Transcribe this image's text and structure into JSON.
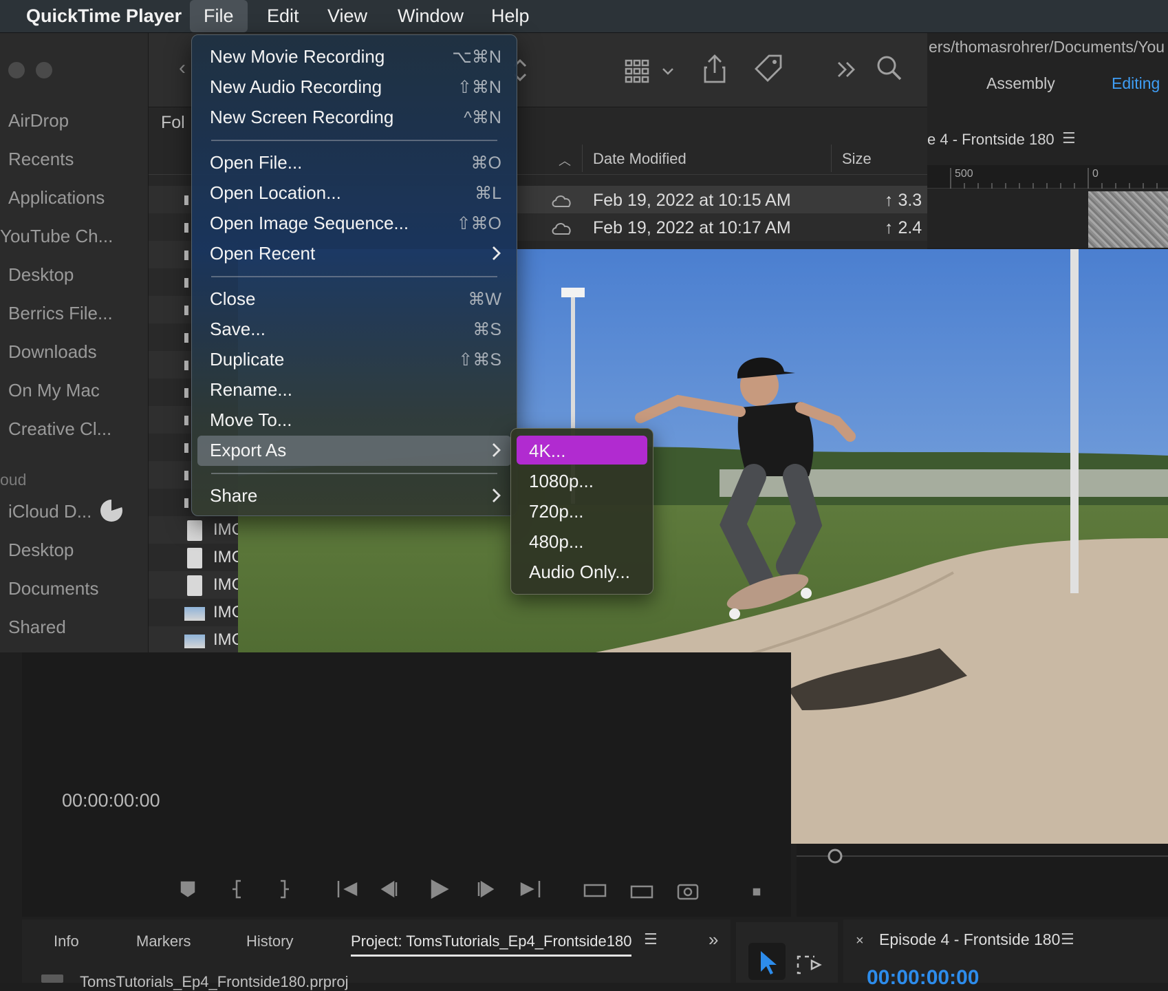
{
  "menubar": {
    "app_name": "QuickTime Player",
    "items": [
      "File",
      "Edit",
      "View",
      "Window",
      "Help"
    ]
  },
  "finder": {
    "sidebar": {
      "items": [
        "AirDrop",
        "Recents",
        "Applications",
        "YouTube Ch...",
        "Desktop",
        "Berrics File...",
        "Downloads",
        "On My Mac",
        "Creative Cl..."
      ],
      "icloud_header": "oud",
      "icloud_items": [
        "iCloud D...",
        "Desktop",
        "Documents",
        "Shared"
      ]
    },
    "folder_col_partial": "Fol",
    "path_text": "ers/thomasrohrer/Documents/You",
    "columns": {
      "date": "Date Modified",
      "size": "Size"
    },
    "rows": [
      {
        "date": "Feb 19, 2022 at 10:15 AM",
        "size": "3.3"
      },
      {
        "date": "Feb 19, 2022 at 10:17 AM",
        "size": "2.4"
      }
    ],
    "file_names": [
      "IMC",
      "IMC",
      "IMC",
      "IMC",
      "IMC"
    ]
  },
  "file_menu": {
    "groups": [
      [
        {
          "label": "New Movie Recording",
          "shortcut": "⌥⌘N"
        },
        {
          "label": "New Audio Recording",
          "shortcut": "⇧⌘N"
        },
        {
          "label": "New Screen Recording",
          "shortcut": "^⌘N"
        }
      ],
      [
        {
          "label": "Open File...",
          "shortcut": "⌘O"
        },
        {
          "label": "Open Location...",
          "shortcut": "⌘L"
        },
        {
          "label": "Open Image Sequence...",
          "shortcut": "⇧⌘O"
        },
        {
          "label": "Open Recent",
          "submenu": true
        }
      ],
      [
        {
          "label": "Close",
          "shortcut": "⌘W"
        },
        {
          "label": "Save...",
          "shortcut": "⌘S"
        },
        {
          "label": "Duplicate",
          "shortcut": "⇧⌘S"
        },
        {
          "label": "Rename..."
        },
        {
          "label": "Move To..."
        },
        {
          "label": "Export As",
          "submenu": true,
          "highlighted": true
        }
      ],
      [
        {
          "label": "Share",
          "submenu": true
        }
      ]
    ]
  },
  "export_submenu": {
    "items": [
      "4K...",
      "1080p...",
      "720p...",
      "480p...",
      "Audio Only..."
    ],
    "selected": "4K..."
  },
  "premiere": {
    "workspace_tabs": [
      "Assembly",
      "Editing"
    ],
    "active_workspace": "Editing",
    "sequence_title_partial": "e 4 - Frontside 180",
    "ruler_labels": [
      "500",
      "0"
    ],
    "timecode": "00:00:00:00",
    "panel_tabs": [
      "Info",
      "Markers",
      "History",
      "Project: TomsTutorials_Ep4_Frontside180"
    ],
    "project_file": "TomsTutorials_Ep4_Frontside180.prproj",
    "sequence_panel_title": "Episode 4 - Frontside 180",
    "sequence_timecode": "00:00:00:00",
    "colors": {
      "accent_blue": "#2d8ceb",
      "submenu_highlight": "#b12bd0"
    }
  }
}
